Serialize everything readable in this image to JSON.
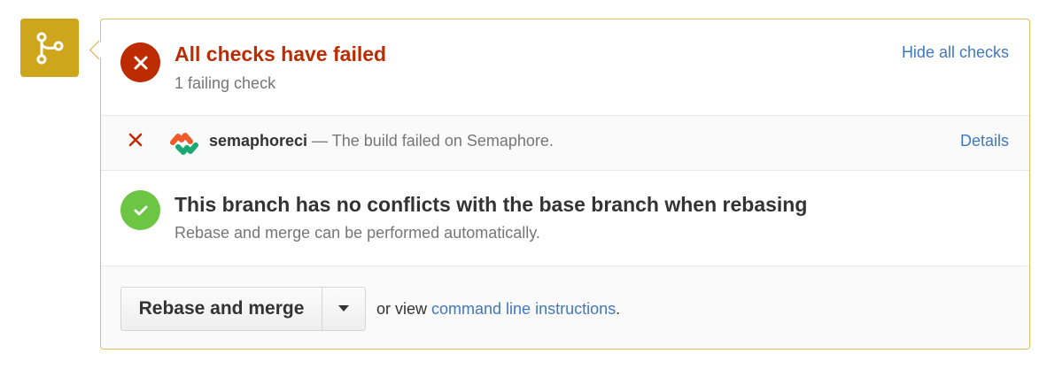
{
  "colors": {
    "branch_icon_bg": "#cea61b",
    "failed_red": "#bd2c00",
    "success_green": "#6cc644",
    "link_blue": "#4078c0",
    "panel_border": "#dcbf59"
  },
  "timeline": {
    "icon": "git-branch-icon"
  },
  "status": {
    "icon": "x-icon",
    "title": "All checks have failed",
    "subtitle": "1 failing check",
    "hide_link": "Hide all checks"
  },
  "checks": [
    {
      "status_icon": "x-icon",
      "logo_icon": "semaphore-logo-icon",
      "name": "semaphoreci",
      "description": " — The build failed on Semaphore.",
      "details_label": "Details"
    }
  ],
  "merge_status": {
    "icon": "checkmark-icon",
    "title": "This branch has no conflicts with the base branch when rebasing",
    "subtitle": "Rebase and merge can be performed automatically."
  },
  "action": {
    "button_label": "Rebase and merge",
    "caret_icon": "caret-down-icon",
    "or_view": "or view ",
    "command_link": "command line instructions",
    "trailing": "."
  }
}
